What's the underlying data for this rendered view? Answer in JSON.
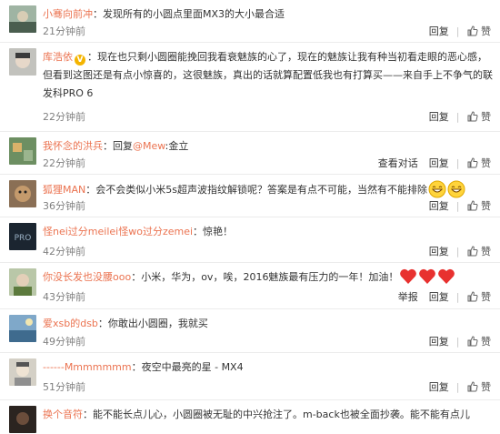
{
  "actions": {
    "reply": "回复",
    "like": "赞",
    "report": "举报",
    "view_conversation": "查看对话"
  },
  "comments": [
    {
      "user": "小骞向前冲",
      "text": "：发现所有的小圆点里面MX3的大小最合适",
      "time": "21分钟前"
    },
    {
      "user": "库浩依",
      "text": "：现在也只剩小圆圈能挽回我看衰魅族的心了，现在的魅族让我有种当初看走眼的恶心感，但看到这图还是有点小惊喜的，这很魅族，真出的话就算配置低我也有打算买——来自手上不争气的联发科PRO 6",
      "time": "22分钟前"
    },
    {
      "user": "我怀念的洪兵",
      "text_prefix": "：回复",
      "mention": "@Mew",
      "text": ":金立",
      "time": "22分钟前"
    },
    {
      "user": "狐狸MAN",
      "text": "：会不会类似小米5s超声波指纹解锁呢？答案是有点不可能，当然有不能排除",
      "time": "36分钟前"
    },
    {
      "user": "怪nei过分meilei怪wo过分zemei",
      "text": "：惊艳！",
      "time": "42分钟前"
    },
    {
      "user": "你没长发也没腰ooo",
      "text": "：小米，华为，ov，唉，2016魅族最有压力的一年！加油！",
      "time": "43分钟前"
    },
    {
      "user": "爱xsb的dsb",
      "text": "：你敢出小圆圈，我就买",
      "time": "49分钟前"
    },
    {
      "user": "------Mmmmmmm",
      "text": "：夜空中最亮的星 - MX4",
      "time": "51分钟前"
    },
    {
      "user": "换个音符",
      "text": "：能不能长点儿心，小圆圈被无耻的中兴抢注了。m-back也被全面抄袭。能不能有点儿",
      "time": ""
    }
  ],
  "colors": {
    "username": "#eb7350",
    "time": "#808080",
    "text": "#333333"
  }
}
